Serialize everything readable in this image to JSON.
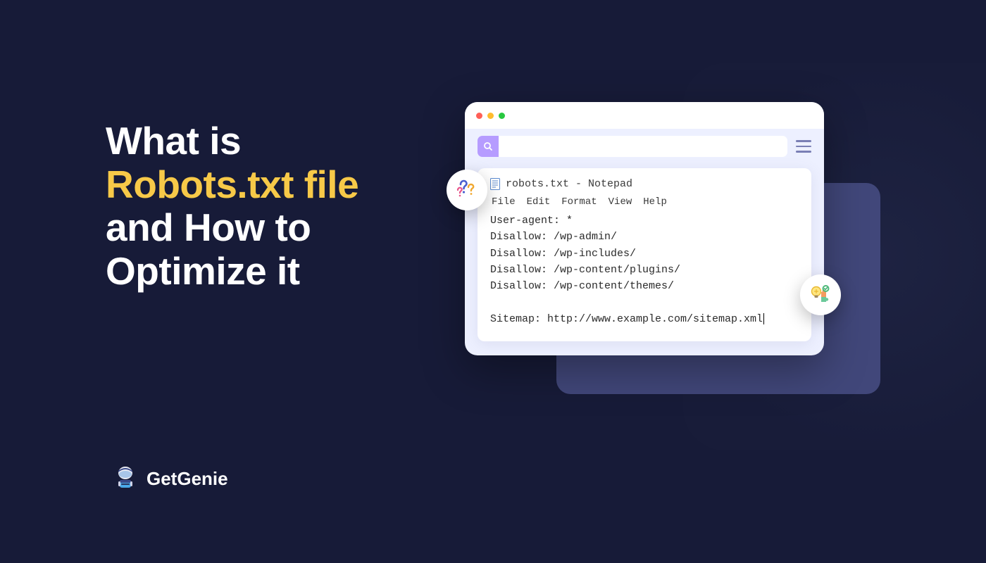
{
  "heading": {
    "line1": "What is",
    "line2_yellow": "Robots.txt file",
    "line3": "and How to",
    "line4": "Optimize it"
  },
  "brand": {
    "name": "GetGenie"
  },
  "browser": {
    "search_placeholder": ""
  },
  "notepad": {
    "title": "robots.txt - Notepad",
    "menu": [
      "File",
      "Edit",
      "Format",
      "View",
      "Help"
    ],
    "lines": [
      "User-agent: *",
      "Disallow: /wp-admin/",
      "Disallow: /wp-includes/",
      "Disallow: /wp-content/plugins/",
      "Disallow: /wp-content/themes/",
      "",
      "Sitemap: http://www.example.com/sitemap.xml"
    ]
  }
}
